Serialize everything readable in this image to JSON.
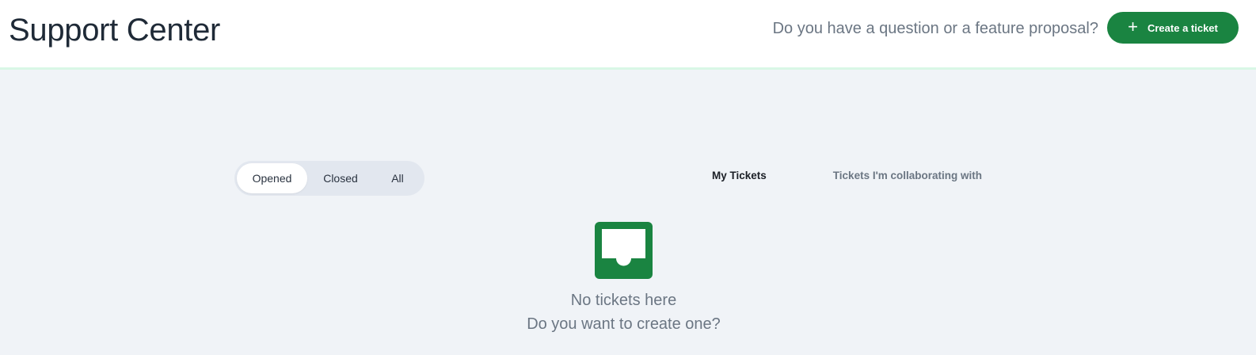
{
  "header": {
    "title": "Support Center",
    "question": "Do you have a question or a feature proposal?",
    "create_button": {
      "icon": "plus-icon",
      "label": "Create a ticket"
    }
  },
  "filters": {
    "status_tabs": [
      {
        "label": "Opened",
        "active": true
      },
      {
        "label": "Closed",
        "active": false
      },
      {
        "label": "All",
        "active": false
      }
    ],
    "scope_tabs": [
      {
        "label": "My Tickets",
        "active": true
      },
      {
        "label": "Tickets I'm collaborating with",
        "active": false
      }
    ]
  },
  "empty_state": {
    "icon": "inbox-icon",
    "title": "No tickets here",
    "subtitle": "Do you want to create one?"
  },
  "colors": {
    "accent": "#1a8441",
    "background": "#f0f3f7",
    "header_border": "#d9f7e6",
    "muted_text": "#6b7683"
  }
}
